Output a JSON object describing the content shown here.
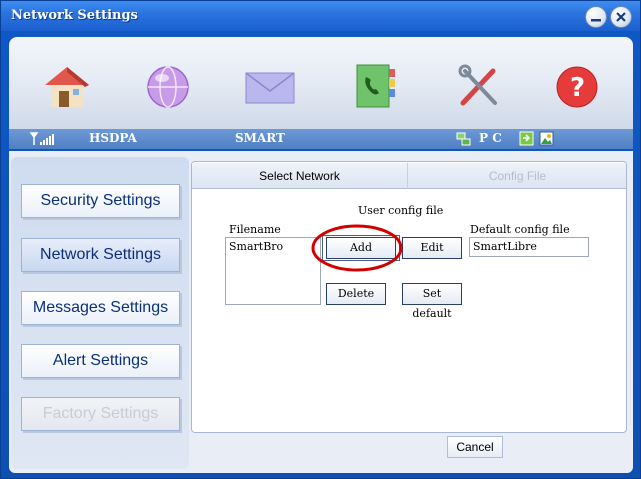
{
  "window": {
    "title": "Network Settings",
    "controls": {
      "minimize": "minimize-icon",
      "close": "close-icon"
    }
  },
  "toolbar": {
    "icons": [
      "home-icon",
      "globe-icon",
      "mail-icon",
      "phonebook-icon",
      "tools-icon",
      "help-icon"
    ]
  },
  "status": {
    "signal_icon": "signal-icon",
    "network_type": "HSDPA",
    "operator": "SMART",
    "connection_label": "P C"
  },
  "sidebar": {
    "items": [
      {
        "label": "Security Settings",
        "state": "normal"
      },
      {
        "label": "Network Settings",
        "state": "active"
      },
      {
        "label": "Messages Settings",
        "state": "normal"
      },
      {
        "label": "Alert Settings",
        "state": "normal"
      },
      {
        "label": "Factory Settings",
        "state": "disabled"
      }
    ]
  },
  "tabs": [
    {
      "label": "Select Network",
      "active": true
    },
    {
      "label": "Config File",
      "active": false
    }
  ],
  "config": {
    "section_title": "User config file",
    "filename_label": "Filename",
    "files": [
      "SmartBro"
    ],
    "default_label": "Default config file",
    "default_value": "SmartLibre",
    "buttons": {
      "add": "Add",
      "edit": "Edit",
      "delete": "Delete",
      "set_default": "Set default"
    }
  },
  "footer": {
    "cancel": "Cancel"
  },
  "colors": {
    "titlebar": "#2b74e0",
    "highlight_ellipse": "#d40000",
    "nav_text": "#0b2f7a"
  }
}
